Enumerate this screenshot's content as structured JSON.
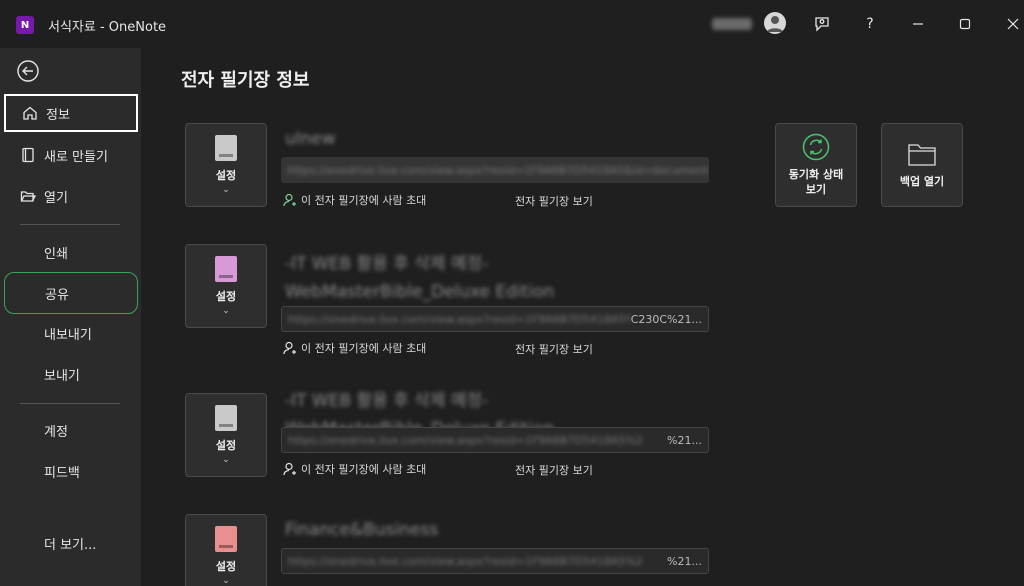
{
  "titlebar": {
    "app_icon_letter": "N",
    "title": "서식자료  -  OneNote",
    "help": "?"
  },
  "sidebar": {
    "items": [
      {
        "label": "정보"
      },
      {
        "label": "새로 만들기"
      },
      {
        "label": "열기"
      },
      {
        "label": "인쇄"
      },
      {
        "label": "공유"
      },
      {
        "label": "내보내기"
      },
      {
        "label": "보내기"
      },
      {
        "label": "계정"
      },
      {
        "label": "피드백"
      },
      {
        "label": "더 보기..."
      }
    ]
  },
  "main": {
    "title": "전자 필기장 정보",
    "sync_button": "동기화 상태 보기",
    "backup_button": "백업 열기",
    "notebooks": [
      {
        "settings": "설정",
        "name": "ulnew",
        "url_blur": "https://onedrive.live.com/view.aspx?resid=1F9A6B7D5418A5&id=documents",
        "url_tail": "",
        "invite": "이 전자 필기장에 사람 초대",
        "view": "전자 필기장 보기",
        "color": "#c9c9c9"
      },
      {
        "settings": "설정",
        "name": "-IT WEB 활용 후 삭제 예정- WebMasterBible_Deluxe Edition",
        "url_blur": "https://onedrive.live.com/view.aspx?resid=1F9A6B7D5418A5%2",
        "url_tail": "C230C%21...",
        "invite": "이 전자 필기장에 사람 초대",
        "view": "전자 필기장 보기",
        "color": "#d79ad6"
      },
      {
        "settings": "설정",
        "name": "-IT WEB 활용 후 삭제 예정- WebMasterBible_Deluxe Edition",
        "url_blur": "https://onedrive.live.com/view.aspx?resid=1F9A6B7D5418A5%2",
        "url_tail": "%21...",
        "invite": "이 전자 필기장에 사람 초대",
        "view": "전자 필기장 보기",
        "color": "#c9c9c9"
      },
      {
        "settings": "설정",
        "name": "Finance&Business",
        "url_blur": "https://onedrive.live.com/view.aspx?resid=1F9A6B7D5418A5%2",
        "url_tail": "%21...",
        "invite": "",
        "view": "",
        "color": "#e98f8f"
      }
    ]
  }
}
